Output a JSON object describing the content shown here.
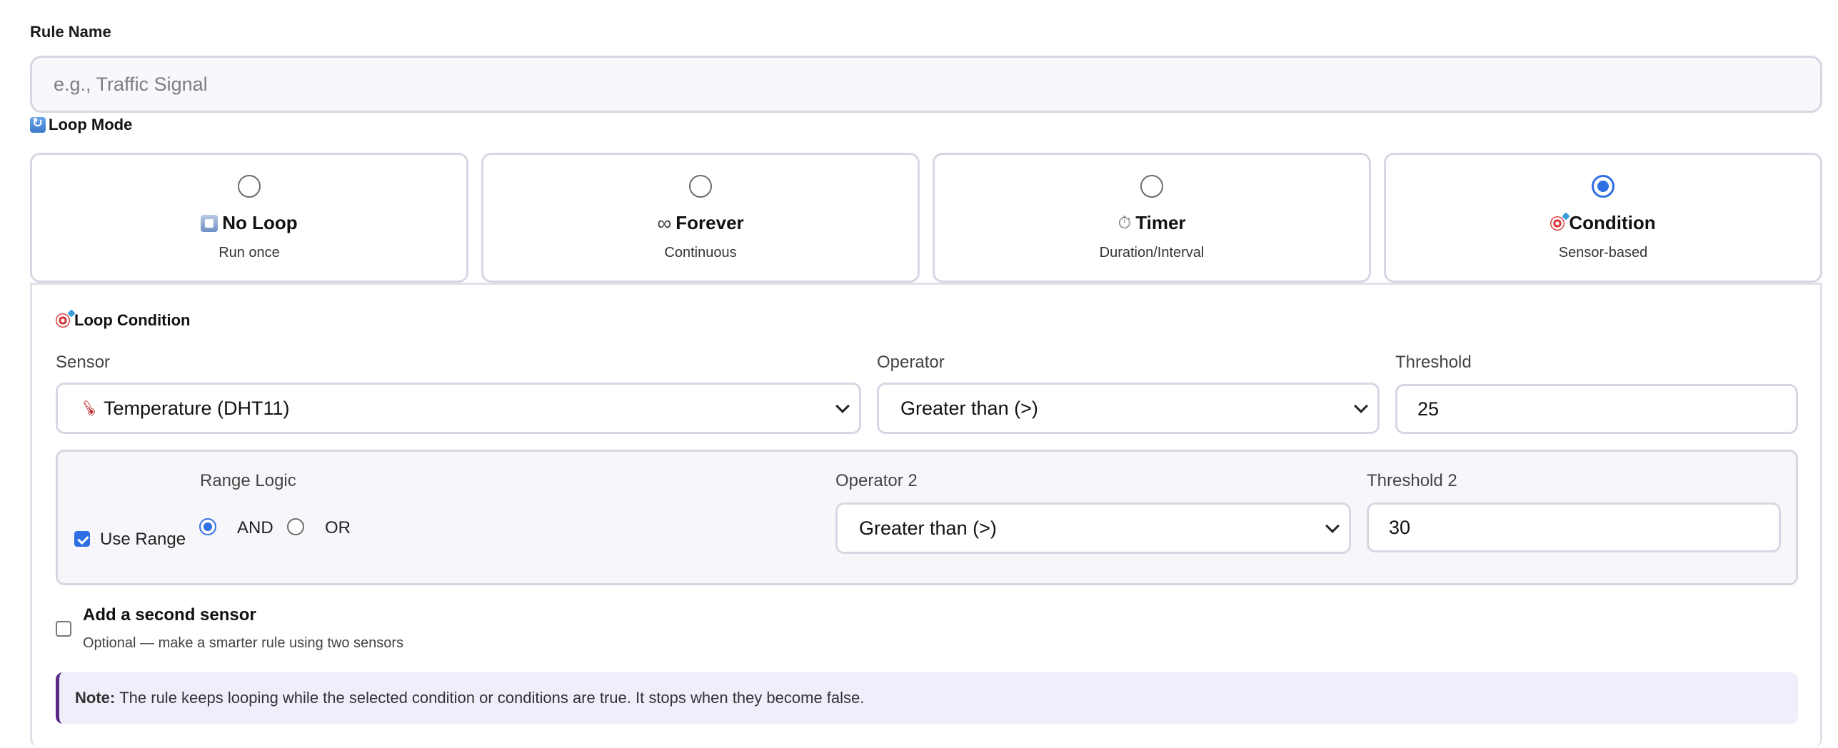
{
  "rule_name": {
    "label": "Rule Name",
    "placeholder": "e.g., Traffic Signal",
    "value": ""
  },
  "loop_mode": {
    "title": "Loop Mode",
    "title_icon": "repeat-icon",
    "options": [
      {
        "label": "No Loop",
        "desc": "Run once",
        "icon": "stop-button-icon",
        "selected": false
      },
      {
        "label": "Forever",
        "desc": "Continuous",
        "icon": "infinity-icon",
        "selected": false
      },
      {
        "label": "Timer",
        "desc": "Duration/Interval",
        "icon": "stopwatch-icon",
        "selected": false
      },
      {
        "label": "Condition",
        "desc": "Sensor-based",
        "icon": "target-icon",
        "selected": true
      }
    ]
  },
  "condition": {
    "title": "Loop Condition",
    "title_icon": "target-icon",
    "sensor_label": "Sensor",
    "sensor_value": "Temperature (DHT11)",
    "sensor_icon": "thermometer-icon",
    "operator_label": "Operator",
    "operator_value": "Greater than (>)",
    "threshold_label": "Threshold",
    "threshold_value": "25",
    "range": {
      "use_range_label": "Use Range",
      "use_range_checked": true,
      "logic_label": "Range Logic",
      "logic_options": [
        "AND",
        "OR"
      ],
      "logic_selected": "AND",
      "operator2_label": "Operator 2",
      "operator2_value": "Greater than (>)",
      "threshold2_label": "Threshold 2",
      "threshold2_value": "30"
    },
    "second_sensor": {
      "title": "Add a second sensor",
      "desc": "Optional — make a smarter rule using two sensors",
      "checked": false
    },
    "note": {
      "label": "Note:",
      "text": "The rule keeps looping while the selected condition or conditions are true. It stops when they become false."
    }
  },
  "colors": {
    "accent": "#2f6fe4",
    "border": "#d9d6e4",
    "note_bg": "#efeefb",
    "note_bar": "#5b2a86"
  }
}
